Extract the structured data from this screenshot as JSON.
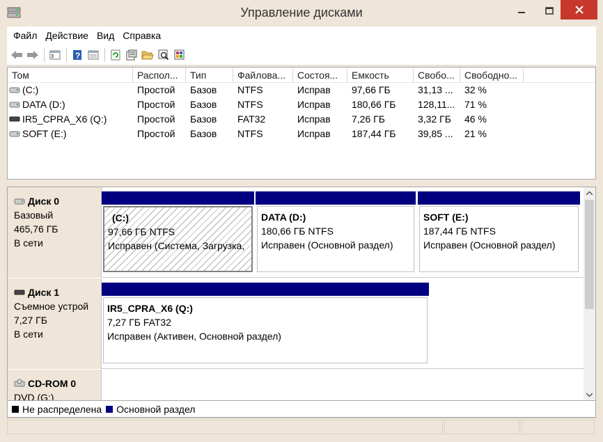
{
  "window": {
    "title": "Управление дисками",
    "icon": "disk-management-icon"
  },
  "menu": [
    "Файл",
    "Действие",
    "Вид",
    "Справка"
  ],
  "toolbar": {
    "icons": [
      "back-icon",
      "forward-icon",
      "properties-icon",
      "help-icon",
      "list-view-icon",
      "refresh-icon",
      "rescan-icon",
      "open-folder-icon",
      "explore-icon",
      "settings-icon"
    ]
  },
  "volumes": {
    "columns": [
      "Том",
      "Распол...",
      "Тип",
      "Файлова...",
      "Состоя...",
      "Емкость",
      "Свобо...",
      "Свободно..."
    ],
    "rows": [
      {
        "name": "(C:)",
        "icon": "drive-icon",
        "layout": "Простой",
        "type": "Базов",
        "fs": "NTFS",
        "status": "Исправ",
        "capacity": "97,66 ГБ",
        "free": "31,13 ...",
        "free_pct": "32 %"
      },
      {
        "name": "DATA (D:)",
        "icon": "drive-icon",
        "layout": "Простой",
        "type": "Базов",
        "fs": "NTFS",
        "status": "Исправ",
        "capacity": "180,66 ГБ",
        "free": "128,11...",
        "free_pct": "71 %"
      },
      {
        "name": "IR5_CPRA_X6 (Q:)",
        "icon": "removable-drive-icon",
        "layout": "Простой",
        "type": "Базов",
        "fs": "FAT32",
        "status": "Исправ",
        "capacity": "7,26 ГБ",
        "free": "3,32 ГБ",
        "free_pct": "46 %"
      },
      {
        "name": "SOFT (E:)",
        "icon": "drive-icon",
        "layout": "Простой",
        "type": "Базов",
        "fs": "NTFS",
        "status": "Исправ",
        "capacity": "187,44 ГБ",
        "free": "39,85 ...",
        "free_pct": "21 %"
      }
    ]
  },
  "disks": [
    {
      "name": "Диск 0",
      "type": "Базовый",
      "size": "465,76 ГБ",
      "state": "В сети",
      "partitions": [
        {
          "title": "(C:)",
          "size_fs": "97,66 ГБ NTFS",
          "status": "Исправен (Система, Загрузка,",
          "selected": true
        },
        {
          "title": "DATA  (D:)",
          "size_fs": "180,66 ГБ NTFS",
          "status": "Исправен (Основной раздел)",
          "selected": false
        },
        {
          "title": "SOFT  (E:)",
          "size_fs": "187,44 ГБ NTFS",
          "status": "Исправен (Основной раздел)",
          "selected": false
        }
      ]
    },
    {
      "name": "Диск 1",
      "type": "Съемное устрой",
      "size": "7,27 ГБ",
      "state": "В сети",
      "partitions": [
        {
          "title": "IR5_CPRA_X6  (Q:)",
          "size_fs": "7,27 ГБ FAT32",
          "status": "Исправен (Активен, Основной раздел)",
          "selected": false
        }
      ]
    },
    {
      "name": "CD-ROM 0",
      "type": "DVD (G:)",
      "size": "",
      "state": "",
      "partitions": []
    }
  ],
  "legend": [
    {
      "label": "Не распределена",
      "color": "#000000"
    },
    {
      "label": "Основной раздел",
      "color": "#000080"
    }
  ]
}
